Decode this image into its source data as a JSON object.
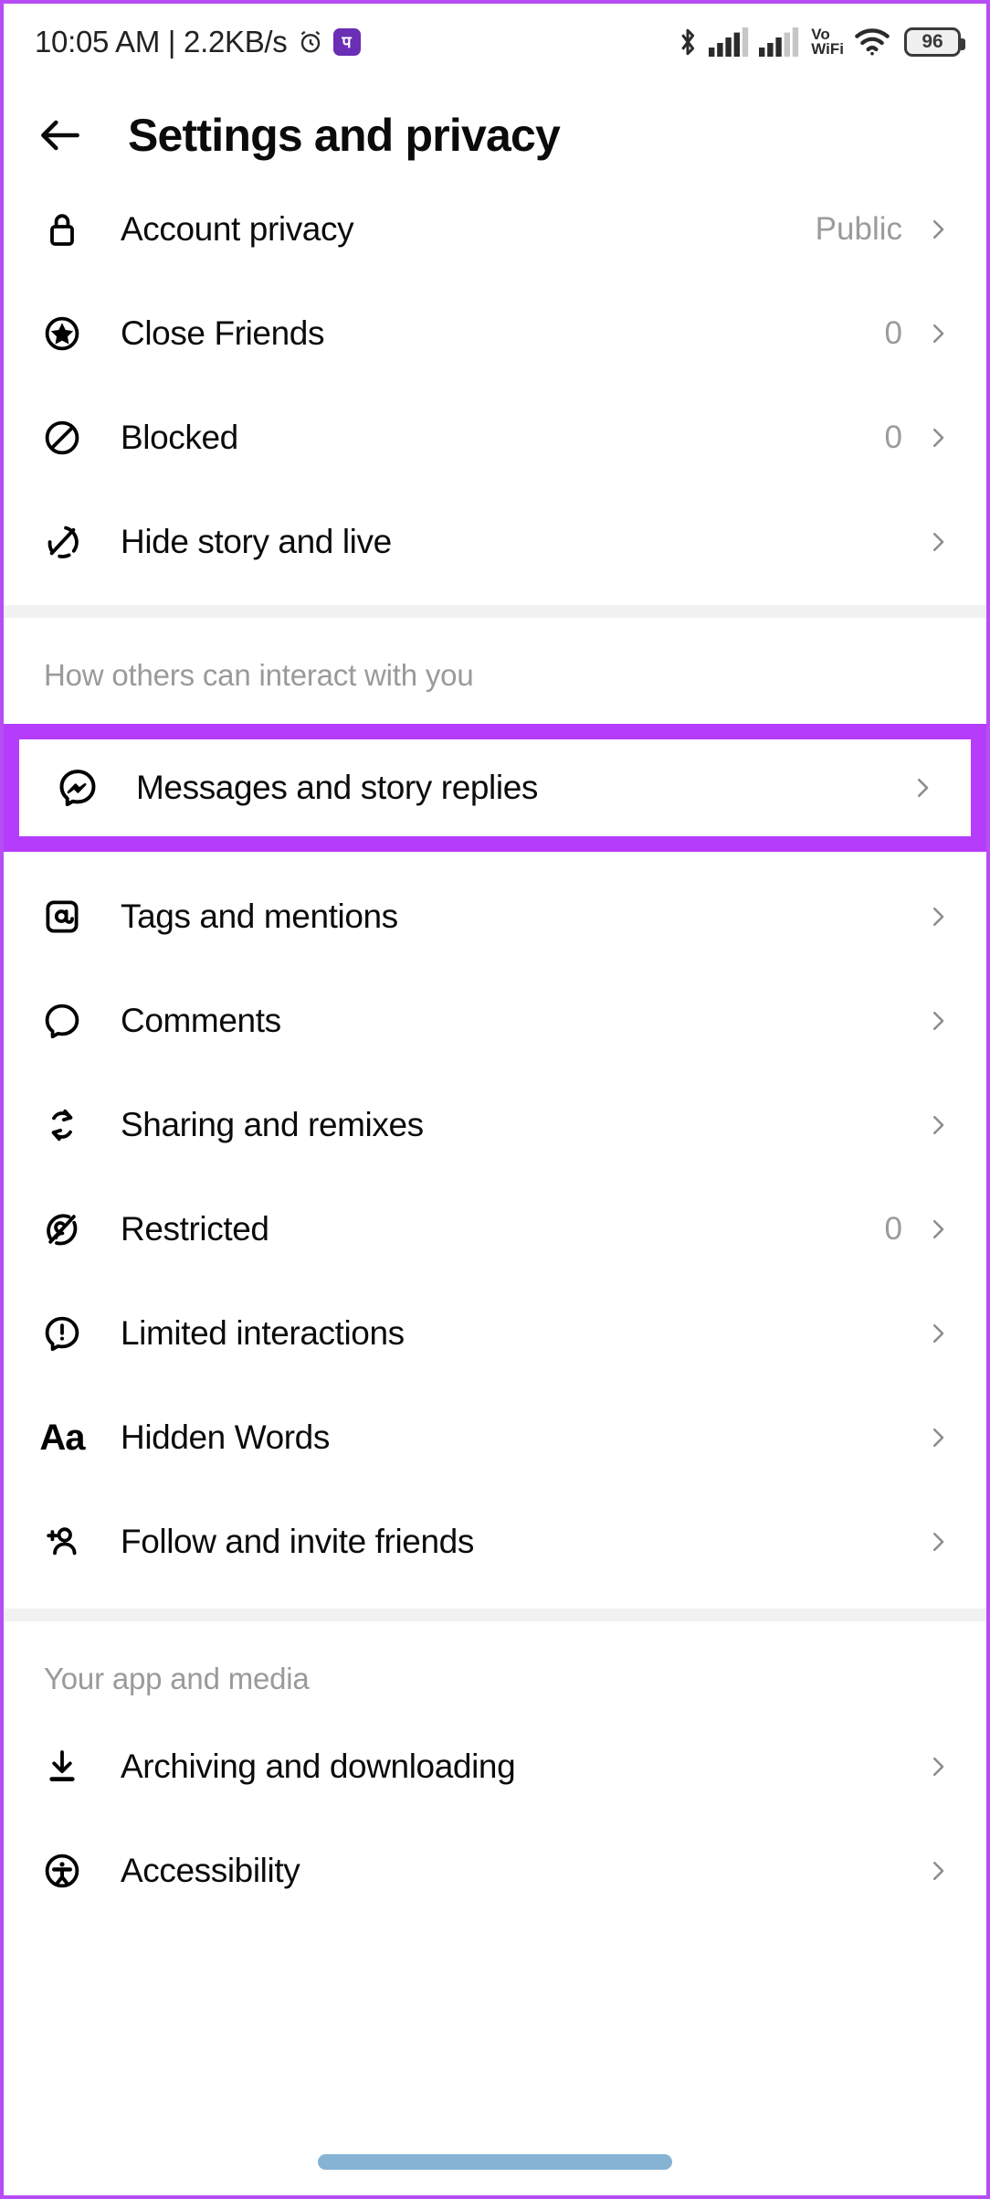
{
  "status_bar": {
    "clock": "10:05 AM | 2.2KB/s",
    "alarm_icon": "alarm-clock-icon",
    "app_badge_icon": "app-badge-icon",
    "app_badge_glyph": "प",
    "bluetooth_icon": "bluetooth-icon",
    "signal_one_icon": "cellular-signal-icon",
    "signal_two_icon": "cellular-signal-icon",
    "volte_line1": "Vo",
    "volte_line2": "WiFi",
    "wifi_icon": "wifi-icon",
    "battery_level": "96",
    "battery_icon": "battery-icon"
  },
  "header": {
    "back_icon": "back-arrow-icon",
    "title": "Settings and privacy"
  },
  "sections": [
    {
      "header": "",
      "items": [
        {
          "icon": "lock-icon",
          "label": "Account privacy",
          "value": "Public"
        },
        {
          "icon": "star-circle-icon",
          "label": "Close Friends",
          "value": "0"
        },
        {
          "icon": "blocked-icon",
          "label": "Blocked",
          "value": "0"
        },
        {
          "icon": "hide-story-icon",
          "label": "Hide story and live",
          "value": ""
        }
      ]
    },
    {
      "header": "How others can interact with you",
      "items": [
        {
          "icon": "messenger-icon",
          "label": "Messages and story replies",
          "value": "",
          "highlighted": true
        },
        {
          "icon": "at-sign-icon",
          "label": "Tags and mentions",
          "value": ""
        },
        {
          "icon": "comment-icon",
          "label": "Comments",
          "value": ""
        },
        {
          "icon": "remix-icon",
          "label": "Sharing and remixes",
          "value": ""
        },
        {
          "icon": "restricted-icon",
          "label": "Restricted",
          "value": "0"
        },
        {
          "icon": "limited-icon",
          "label": "Limited interactions",
          "value": ""
        },
        {
          "icon": "hidden-words-icon",
          "label": "Hidden Words",
          "value": ""
        },
        {
          "icon": "add-person-icon",
          "label": "Follow and invite friends",
          "value": ""
        }
      ]
    },
    {
      "header": "Your app and media",
      "items": [
        {
          "icon": "download-icon",
          "label": "Archiving and downloading",
          "value": ""
        },
        {
          "icon": "accessibility-icon",
          "label": "Accessibility",
          "value": ""
        }
      ]
    }
  ],
  "colors": {
    "annotation_purple": "#b63cfb",
    "device_border": "#b84cf5",
    "value_gray": "#9b9b9b",
    "section_header_gray": "#9a9a9a",
    "home_indicator_blue": "#86b3d4"
  },
  "home_indicator": "home-indicator"
}
